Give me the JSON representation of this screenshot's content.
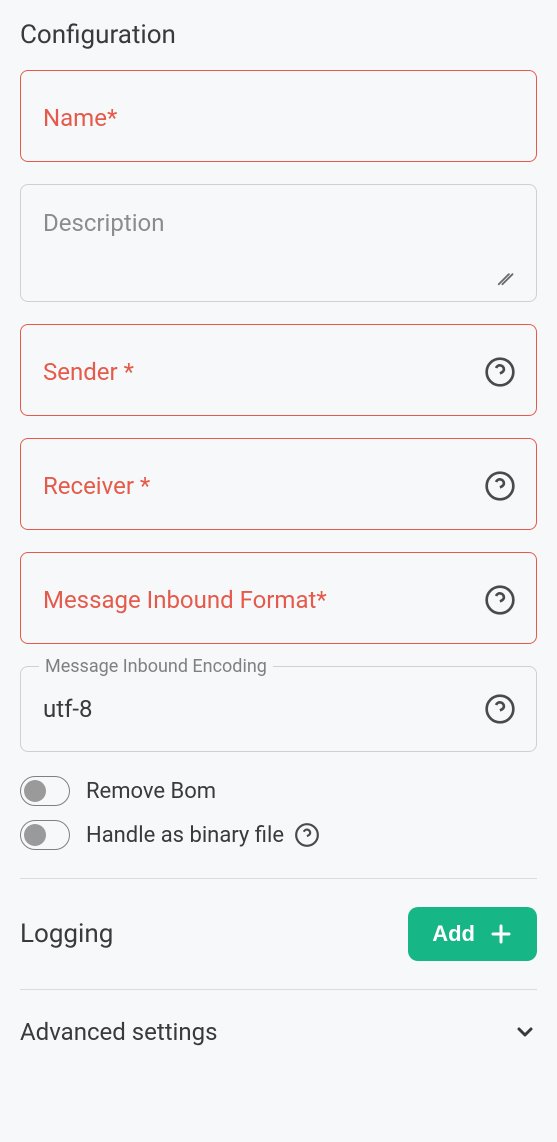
{
  "section_title": "Configuration",
  "fields": {
    "name": {
      "label": "Name*"
    },
    "description": {
      "label": "Description"
    },
    "sender": {
      "label": "Sender *"
    },
    "receiver": {
      "label": "Receiver *"
    },
    "inbound_format": {
      "label": "Message Inbound Format*"
    },
    "inbound_encoding": {
      "label": "Message Inbound Encoding",
      "value": "utf-8"
    }
  },
  "toggles": {
    "remove_bom": "Remove Bom",
    "handle_binary": "Handle as binary file"
  },
  "logging": {
    "title": "Logging",
    "add_label": "Add"
  },
  "advanced": {
    "title": "Advanced settings"
  }
}
